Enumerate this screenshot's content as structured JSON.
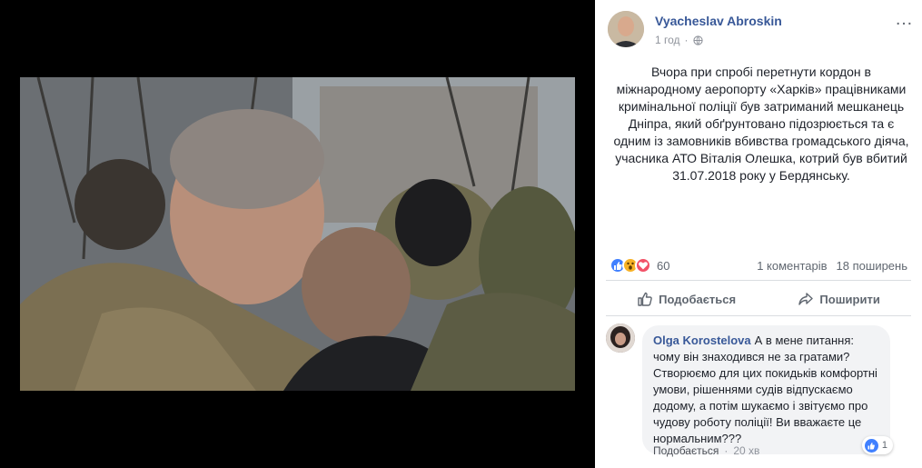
{
  "post": {
    "author": "Vyacheslav Abroskin",
    "time": "1 год",
    "more_icon": "…",
    "text": "Вчора при спробі перетнути кордон в міжнародному аеропорту «Харків» працівниками кримінальної поліції був затриманий мешканець Дніпра, який обґрунтовано підозрюється та є одним із замовників вбивства громадського діяча, учасника АТО Віталія Олешка, котрий був вбитий 31.07.2018 року у Бердянську."
  },
  "reactions": {
    "icons": [
      "like-icon",
      "wow-icon",
      "love-icon"
    ],
    "count": "60",
    "comments": "1 коментарів",
    "shares": "18 поширень"
  },
  "actions": {
    "like": "Подобається",
    "share": "Поширити"
  },
  "comment": {
    "author": "Olga Korostelova",
    "text": "А в мене питання: чому він знаходився не за гратами? Створюємо для цих покидьків комфортні умови, рішеннями судів відпускаємо додому, а потім шукаємо і звітуємо про чудову роботу поліції! Ви вважаєте це нормальним???",
    "reaction_count": "1",
    "like_label": "Подобається",
    "separator": "·",
    "time": "20 хв"
  },
  "colors": {
    "link": "#385898",
    "meta": "#90949c",
    "like_blue": "#4080ff",
    "wow": "#f7b125",
    "love": "#f25268"
  }
}
